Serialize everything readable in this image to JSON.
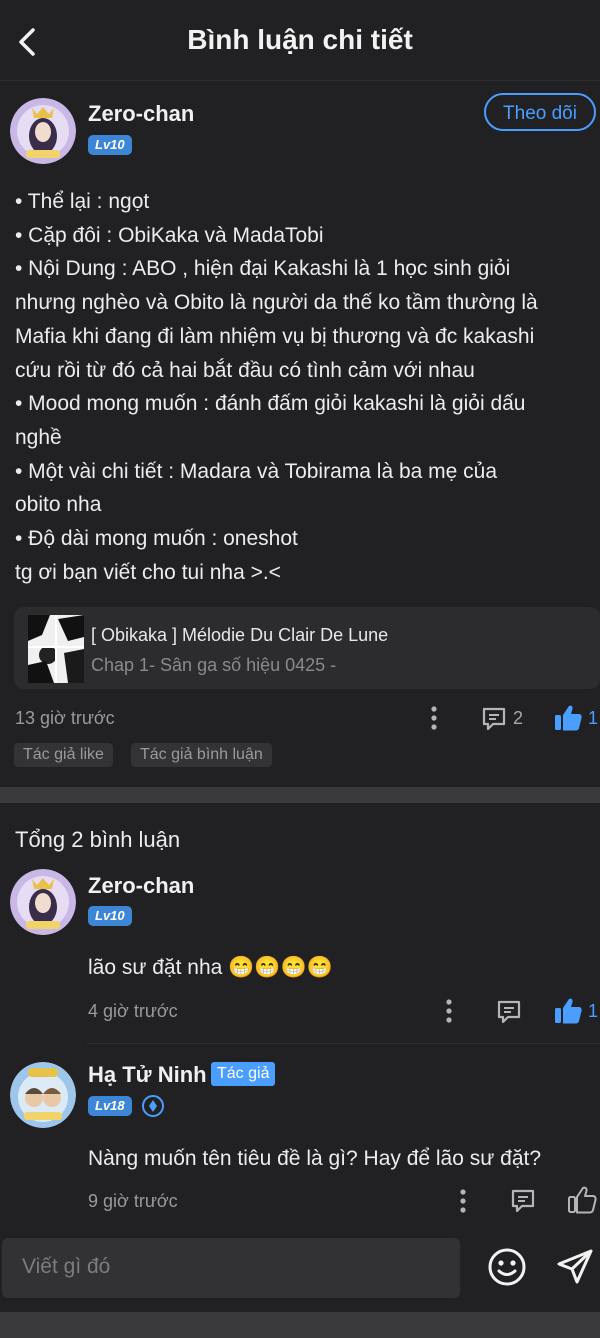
{
  "header": {
    "title": "Bình luận chi tiết",
    "back_icon": "chevron-left-icon"
  },
  "post": {
    "author": "Zero-chan",
    "level": "Lv10",
    "follow_label": "Theo dõi",
    "lines": [
      "• Thể lại : ngọt",
      "• Cặp đôi : ObiKaka và MadaTobi",
      "• Nội Dung : ABO , hiện đại Kakashi là 1 học sinh giỏi",
      "nhưng nghèo và Obito là người da thế ko tầm thường là",
      "Mafia khi đang đi làm nhiệm vụ bị thương và đc kakashi",
      "cứu rồi từ đó cả hai bắt đầu có tình cảm với nhau",
      "• Mood mong muốn : đánh đấm giỏi kakashi là giỏi dấu",
      "nghề",
      "• Một vài chi tiết  : Madara và Tobirama là ba mẹ của",
      "obito nha",
      "• Độ dài mong muốn : oneshot",
      "tg ơi bạn viết cho tui nha >.<"
    ],
    "ref_title": "[ Obikaka ] Mélodie Du Clair De Lune",
    "ref_subtitle": "Chap 1- Sân ga số hiệu 0425 -",
    "time": "13 giờ trước",
    "comment_count": "2",
    "like_count": "1",
    "tags": [
      "Tác giả like",
      "Tác giả bình luận"
    ]
  },
  "comments_header": "Tổng 2 bình luận",
  "comments": [
    {
      "author": "Zero-chan",
      "level": "Lv10",
      "text": "lão sư đặt nha 😁😁😁😁",
      "time": "4 giờ trước",
      "like_count": "1"
    },
    {
      "author": "Hạ Tử Ninh",
      "badge": "Tác giả",
      "level": "Lv18",
      "text": "Nàng muốn tên tiêu đề là gì? Hay để lão sư đặt?",
      "time": "9 giờ trước"
    }
  ],
  "input": {
    "placeholder": "Viết gì đó"
  },
  "colors": {
    "background": "#212124",
    "accent": "#4a9eff",
    "level_badge": "#3d86d6"
  }
}
